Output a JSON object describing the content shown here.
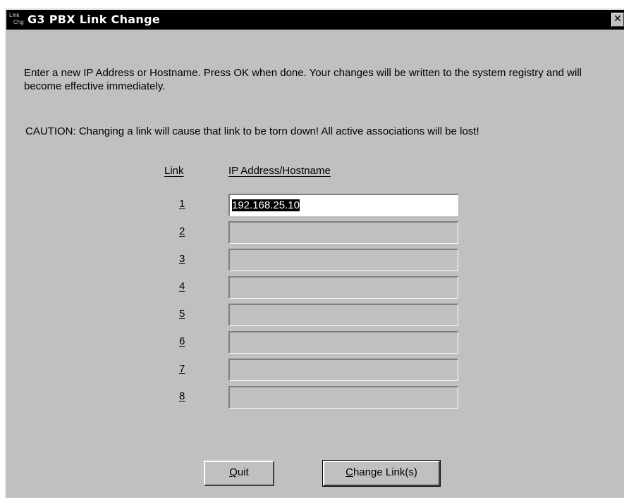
{
  "window": {
    "title": "G3 PBX Link Change",
    "icon_text_top": "Link",
    "icon_text_bottom": "Chg",
    "close_glyph": "✕"
  },
  "message": "Enter a new IP Address or Hostname. Press OK when done. Your changes will be written to the system registry and will become effective immediately.",
  "caution": "CAUTION: Changing a link will cause that link to be torn down! All active associations will be lost!",
  "table": {
    "link_header": "Link",
    "ip_header": "IP Address/Hostname",
    "rows": [
      {
        "num": "1",
        "value": "192.168.25.10"
      },
      {
        "num": "2",
        "value": ""
      },
      {
        "num": "3",
        "value": ""
      },
      {
        "num": "4",
        "value": ""
      },
      {
        "num": "5",
        "value": ""
      },
      {
        "num": "6",
        "value": ""
      },
      {
        "num": "7",
        "value": ""
      },
      {
        "num": "8",
        "value": ""
      }
    ]
  },
  "buttons": {
    "quit_mnemonic": "Q",
    "quit_rest": "uit",
    "change_mnemonic": "C",
    "change_rest": "hange Link(s)"
  }
}
